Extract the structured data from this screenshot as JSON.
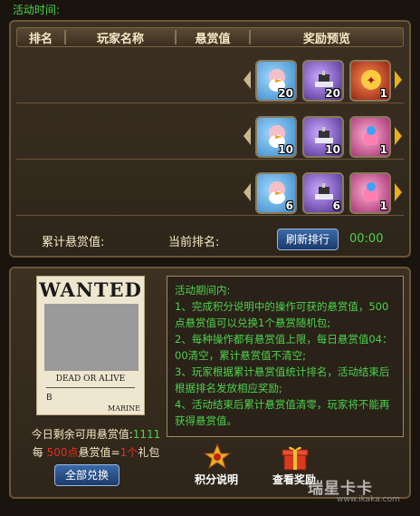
{
  "activity_time_label": "活动时间:",
  "ranking": {
    "headers": [
      "排名",
      "玩家名称",
      "悬赏值",
      "奖励预览"
    ],
    "rows": [
      {
        "rewards": [
          {
            "icon": "penguin-chopper-icon",
            "count": "20"
          },
          {
            "icon": "ship-icon",
            "count": "20"
          },
          {
            "icon": "fire-emblem-icon",
            "count": "1"
          }
        ]
      },
      {
        "rewards": [
          {
            "icon": "penguin-chopper-icon",
            "count": "10"
          },
          {
            "icon": "ship-icon",
            "count": "10"
          },
          {
            "icon": "gift-bag-icon",
            "count": "1"
          }
        ]
      },
      {
        "rewards": [
          {
            "icon": "penguin-chopper-icon",
            "count": "6"
          },
          {
            "icon": "ship-icon",
            "count": "6"
          },
          {
            "icon": "gift-bag-icon",
            "count": "1"
          }
        ]
      }
    ],
    "total_bounty_label": "累计悬赏值:",
    "current_rank_label": "当前排名:",
    "refresh_button": "刷新排行",
    "countdown": "00:00"
  },
  "wanted_poster": {
    "title": "WANTED",
    "subtitle": "DEAD OR ALIVE",
    "symbol": "B",
    "marine": "MARINE"
  },
  "remaining": {
    "label": "今日剩余可用悬赏值:",
    "value": "1111"
  },
  "pack_rule": {
    "prefix": "每",
    "amount": "500",
    "unit": "点",
    "middle": "悬赏值=",
    "count": "1个",
    "suffix": "礼包"
  },
  "exchange_all_button": "全部兑换",
  "rules": {
    "title": "活动期间内:",
    "lines": [
      "1、完成积分说明中的操作可获的悬赏值，500点悬赏值可以兑换1个悬赏随机包;",
      "2、每种操作都有悬赏值上限，每日悬赏值04：00清空，累计悬赏值不清空;",
      "3、玩家根据累计悬赏值统计排名，活动结束后根据排名发放相应奖励;",
      "4、活动结束后累计悬赏值清零，玩家将不能再获得悬赏值。"
    ]
  },
  "points_button": "积分说明",
  "rewards_button": "查看奖励",
  "watermark": "瑞星卡卡",
  "watermark_sub": "www.ikaka.com",
  "colors": {
    "accent_green": "#4cd24c",
    "highlight_red": "#e03020",
    "panel_border": "#6b5536"
  }
}
